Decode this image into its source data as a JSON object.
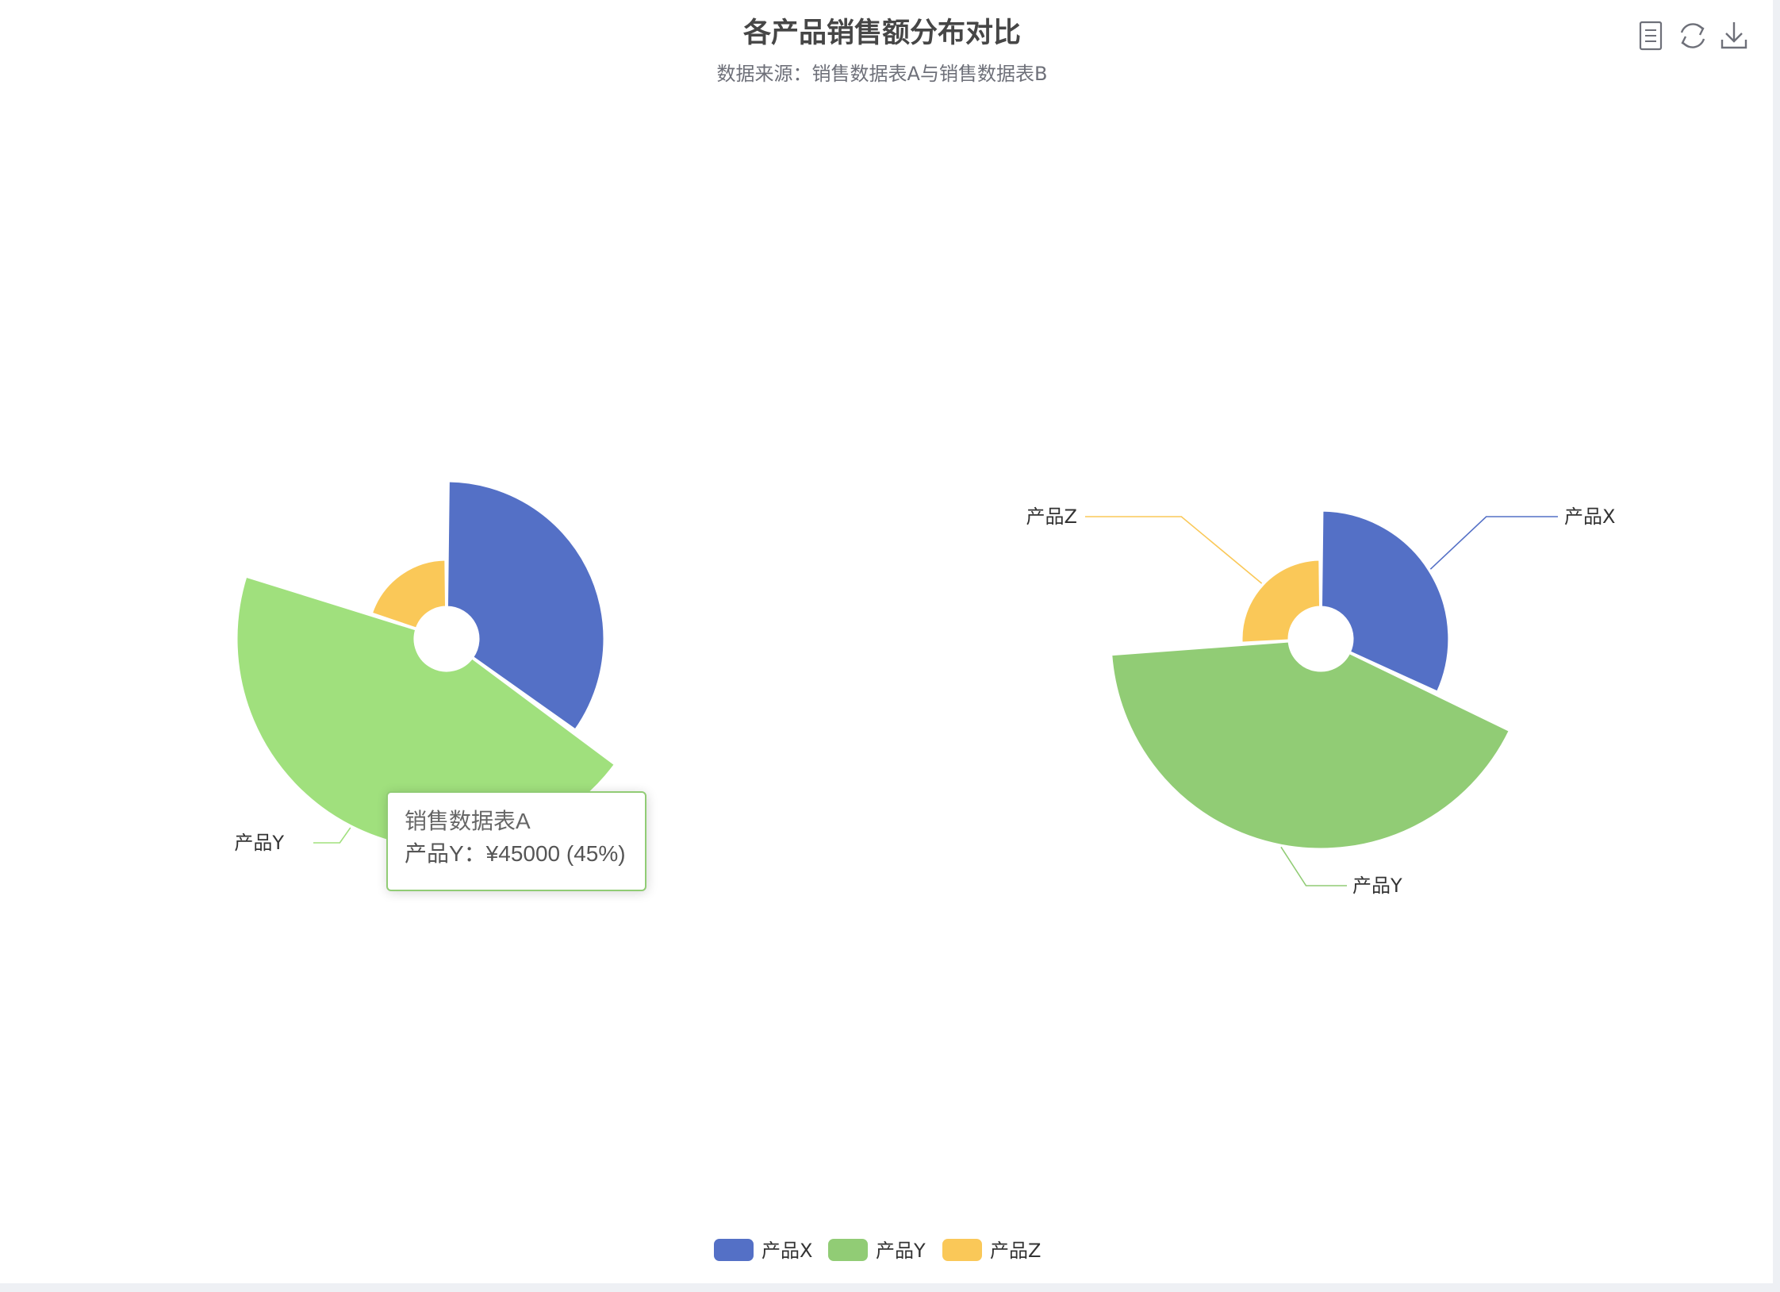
{
  "toolbox": {
    "data_view_icon": "document-icon",
    "restore_icon": "refresh-icon",
    "save_icon": "download-icon"
  },
  "colors": {
    "product_x": "#5470c6",
    "product_y_a": "#a0e07d",
    "product_y_b": "#91cc75",
    "product_z": "#fac858"
  },
  "chart_data": {
    "type": "pie",
    "title": "各产品销售额分布对比",
    "subtitle": "数据来源：销售数据表A与销售数据表B",
    "rose_type": "radius",
    "legend": {
      "position": "bottom-center",
      "items": [
        {
          "name": "产品X",
          "color": "#5470c6"
        },
        {
          "name": "产品Y",
          "color": "#91cc75"
        },
        {
          "name": "产品Z",
          "color": "#fac858"
        }
      ]
    },
    "series": [
      {
        "name": "销售数据表A",
        "data": [
          {
            "name": "产品X",
            "value": 35000
          },
          {
            "name": "产品Y",
            "value": 45000
          },
          {
            "name": "产品Z",
            "value": 20000
          }
        ]
      },
      {
        "name": "销售数据表B",
        "data": [
          {
            "name": "产品X",
            "value": 32000
          },
          {
            "name": "产品Y",
            "value": 42000
          },
          {
            "name": "产品Z",
            "value": 26000
          }
        ]
      }
    ],
    "tooltip": {
      "title": "销售数据表A",
      "row": "产品Y：¥45000 (45%)"
    }
  }
}
